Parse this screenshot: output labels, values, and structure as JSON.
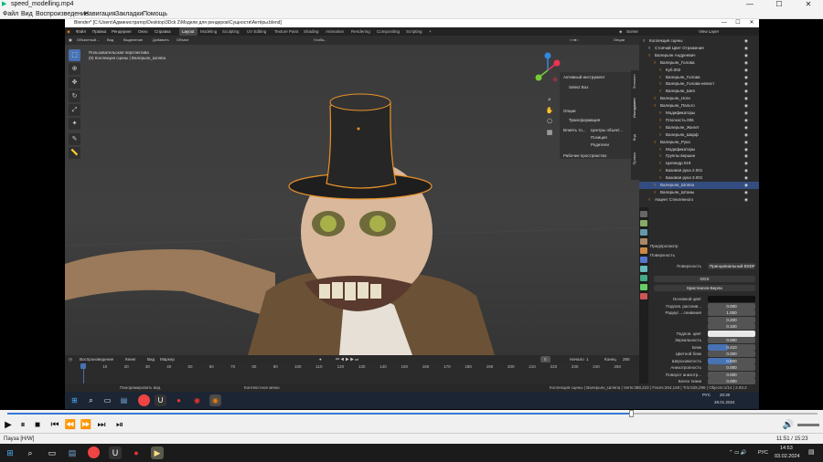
{
  "player": {
    "file_title": "speed_modelling.mp4",
    "menu": [
      "Файл",
      "Вид",
      "Воспроизведение",
      "Навигация",
      "Закладки",
      "Помощь"
    ],
    "status_text": "Пауза [H/W]",
    "time_readout": "11:51 / 15:23"
  },
  "blender": {
    "window_title": "Blender* [C:\\Users\\Администратор\\Desktop\\3Dсk 2\\Модели для рендеров\\Сущности\\Актёры.blend]",
    "top_menu": [
      "Файл",
      "Правка",
      "Рендеринг",
      "Окно",
      "Справка"
    ],
    "workspaces": [
      "Layout",
      "Modeling",
      "Sculpting",
      "UV Editing",
      "Texture Paint",
      "Shading",
      "Animation",
      "Rendering",
      "Compositing",
      "Scripting"
    ],
    "active_workspace": "Layout",
    "scene_label": "Scene",
    "view_layer_label": "View Layer",
    "viewport_header": {
      "mode": "Объектный ...",
      "items": [
        "Вид",
        "Выделение",
        "Добавить",
        "Объект"
      ],
      "transform": "Глоба...",
      "options": "Опции"
    },
    "viewport_info": {
      "line1": "Пользовательская перспектива",
      "line2": "(0) Коллекция сцены | Валерьян_Шляпа"
    },
    "n_panel": {
      "active_tool": "Активный инструмент",
      "select_box": "Select Box",
      "options": "Опции",
      "transform": "Трансформация",
      "affect": "Влиять то...",
      "affect_opts": [
        "Центры объект...",
        "Позиция",
        "Родители"
      ],
      "workspace": "Рабочее пространство"
    },
    "n_tabs": [
      "Элемент",
      "Инструмент",
      "Вид",
      "Правка"
    ],
    "outliner": [
      "Коллекция сцены",
      "Стоячий Цвет Отражения",
      "Валерьян Андреевич",
      "Валерьян_Голова",
      "Куб.002",
      "Валерьян_Голова",
      "Валерьян_Голова-нелист",
      "Валерьян_Шея",
      "Валерьян_Ноги",
      "Валерьян_Пальто",
      "Модификаторы",
      "Плоскость.006",
      "Валерьян_Жилет",
      "Валерьян_Шарф",
      "Валерьян_Рука",
      "Модификаторы",
      "Группы вершин",
      "Цилиндр.019",
      "Базовая рука 2.001",
      "Базовая рука 3.001",
      "Валерьян_Шляпа",
      "Валерьян_Штаны",
      "Акцент Стеклянного"
    ],
    "selected_outliner_index": 20,
    "properties": {
      "preview": "Предпросмотр",
      "surface_section": "Поверхность",
      "surface_label": "Поверхность",
      "surface_value": "Принципиальный BSDF",
      "ggx": "GGX",
      "sss_method": "Кристенсен-Берли",
      "rows": [
        {
          "label": "Основной цвет",
          "value": ""
        },
        {
          "label": "Подпов. рассеив...",
          "value": "0.000"
        },
        {
          "label": "Радиус ...сеивания",
          "value": "1.000"
        },
        {
          "label": "",
          "value": "0.200"
        },
        {
          "label": "",
          "value": "0.100"
        },
        {
          "label": "Подпов. цвет",
          "value": ""
        },
        {
          "label": "Зеркальность",
          "value": "0.000"
        },
        {
          "label": "Блик",
          "value": "0.410"
        },
        {
          "label": "Цветной блик",
          "value": "0.000"
        },
        {
          "label": "Шероховатость",
          "value": "0.500"
        },
        {
          "label": "Анизотропность",
          "value": "0.000"
        },
        {
          "label": "Поворот анизотр...",
          "value": "0.000"
        },
        {
          "label": "Блеск ткани",
          "value": "0.000"
        }
      ]
    },
    "timeline": {
      "menu": [
        "Воспроизведение",
        "Кеинг",
        "Вид",
        "Маркер"
      ],
      "current_frame": "0",
      "start_label": "Начало",
      "start": "1",
      "end_label": "Конец",
      "end": "250",
      "ticks": [
        "0",
        "10",
        "20",
        "30",
        "40",
        "50",
        "60",
        "70",
        "80",
        "90",
        "100",
        "110",
        "120",
        "130",
        "140",
        "150",
        "160",
        "170",
        "180",
        "190",
        "200",
        "210",
        "220",
        "230",
        "240",
        "250"
      ]
    },
    "status_bar": {
      "left": "Панорамировать вид",
      "middle": "Контекстное меню",
      "right": "Коллекция сцены | Валерьян_Шляпа | Verts:388,223 | Faces:264,148 | Tris:528,296 | Objects:1/14 | 2.93.2"
    },
    "inner_clock": {
      "time": "20:30",
      "date": "28.01.2024"
    },
    "inner_lang": "РУС"
  },
  "taskbar": {
    "lang": "РУС",
    "time": "14:53",
    "date": "03.02.2024"
  }
}
